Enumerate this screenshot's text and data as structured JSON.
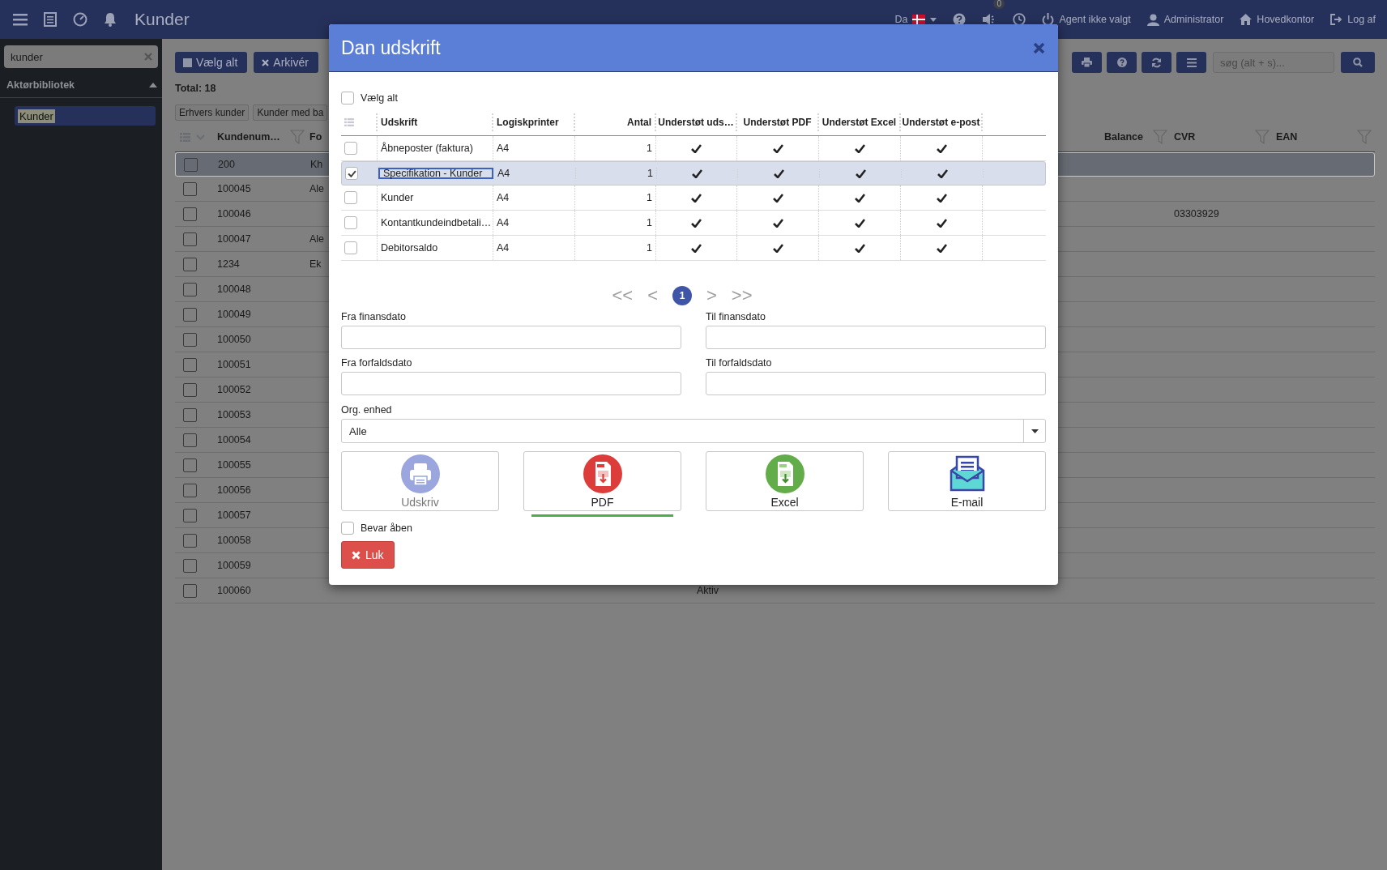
{
  "topbar": {
    "title": "Kunder",
    "language": "Da",
    "notification_count": "0",
    "agent": "Agent ikke valgt",
    "user": "Administrator",
    "office": "Hovedkontor",
    "logout": "Log af"
  },
  "sidebar": {
    "search": {
      "value": "kunder"
    },
    "section": {
      "title": "Aktørbibliotek",
      "expanded": true
    },
    "items": [
      {
        "label": "Kunder",
        "selected": true
      }
    ]
  },
  "toolbar": {
    "buttons": [
      {
        "label": "Vælg alt",
        "kind": "select"
      },
      {
        "label": "Arkivér",
        "kind": "archive"
      }
    ],
    "search": {
      "placeholder": "søg (alt + s)..."
    }
  },
  "total": "Total: 18",
  "filters": [
    "Erhvers kunder",
    "Kunder med ba"
  ],
  "table": {
    "columns": {
      "customer_number": "Kundenum…",
      "column_3": "Fo",
      "balance": "Balance",
      "cvr": "CVR",
      "ean": "EAN"
    },
    "rows": [
      {
        "customer_number": "200",
        "column_3": "Kh",
        "selected": true,
        "checked": false
      },
      {
        "customer_number": "100045",
        "column_3": "Ale",
        "selected": false,
        "checked": false
      },
      {
        "customer_number": "100046",
        "cvr": "03303929",
        "selected": false,
        "checked": false
      },
      {
        "customer_number": "100047",
        "column_3": "Ale",
        "selected": false,
        "checked": false
      },
      {
        "customer_number": "1234",
        "column_3": "Ek",
        "selected": false,
        "checked": false
      },
      {
        "customer_number": "100048",
        "selected": false,
        "checked": false
      },
      {
        "customer_number": "100049",
        "selected": false,
        "checked": false
      },
      {
        "customer_number": "100050",
        "selected": false,
        "checked": false
      },
      {
        "customer_number": "100051",
        "selected": false,
        "checked": false
      },
      {
        "customer_number": "100052",
        "selected": false,
        "checked": false
      },
      {
        "customer_number": "100053",
        "selected": false,
        "checked": false
      },
      {
        "customer_number": "100054",
        "selected": false,
        "checked": false
      },
      {
        "customer_number": "100055",
        "selected": false,
        "checked": false
      },
      {
        "customer_number": "100056",
        "selected": false,
        "checked": false
      },
      {
        "customer_number": "100057",
        "selected": false,
        "checked": false
      },
      {
        "customer_number": "100058",
        "selected": false,
        "checked": false
      },
      {
        "customer_number": "100059",
        "selected": false,
        "checked": false
      },
      {
        "customer_number": "100060",
        "column_4": "Aktiv",
        "selected": false,
        "checked": false
      }
    ]
  },
  "dialog": {
    "title": "Dan udskrift",
    "select_all": {
      "label": "Vælg alt",
      "checked": false
    },
    "table": {
      "columns": [
        "Udskrift",
        "Logiskprinter",
        "Antal",
        "Understøt uds…",
        "Understøt PDF",
        "Understøt Excel",
        "Understøt e-post"
      ],
      "rows": [
        {
          "name": "Åbneposter (faktura)",
          "printer": "A4",
          "count": "1",
          "print": true,
          "pdf": true,
          "excel": true,
          "email": true,
          "checked": false,
          "selected": false
        },
        {
          "name": "Specifikation - Kunder",
          "printer": "A4",
          "count": "1",
          "print": true,
          "pdf": true,
          "excel": true,
          "email": true,
          "checked": true,
          "selected": true
        },
        {
          "name": "Kunder",
          "printer": "A4",
          "count": "1",
          "print": true,
          "pdf": true,
          "excel": true,
          "email": true,
          "checked": false,
          "selected": false
        },
        {
          "name": "Kontantkundeindbetali…",
          "printer": "A4",
          "count": "1",
          "print": true,
          "pdf": true,
          "excel": true,
          "email": true,
          "checked": false,
          "selected": false
        },
        {
          "name": "Debitorsaldo",
          "printer": "A4",
          "count": "1",
          "print": true,
          "pdf": true,
          "excel": true,
          "email": true,
          "checked": false,
          "selected": false
        }
      ]
    },
    "pager": {
      "first": "<<",
      "prev": "<",
      "pages": [
        {
          "label": "1",
          "selected": true
        }
      ],
      "next": ">",
      "last": ">>"
    },
    "fields": [
      {
        "label": "Fra finansdato"
      },
      {
        "label": "Til finansdato"
      },
      {
        "label": "Fra forfaldsdato"
      },
      {
        "label": "Til forfaldsdato"
      }
    ],
    "org_unit": {
      "label": "Org. enhed",
      "value": "Alle"
    },
    "actions": [
      {
        "kind": "print",
        "label": "Udskriv",
        "disabled": true,
        "selected": false
      },
      {
        "kind": "pdf",
        "label": "PDF",
        "disabled": false,
        "selected": true
      },
      {
        "kind": "excel",
        "label": "Excel",
        "disabled": false,
        "selected": false
      },
      {
        "kind": "email",
        "label": "E-mail",
        "disabled": false,
        "selected": false
      }
    ],
    "keep_open": {
      "label": "Bevar åben",
      "checked": false
    },
    "close_button": "Luk"
  }
}
